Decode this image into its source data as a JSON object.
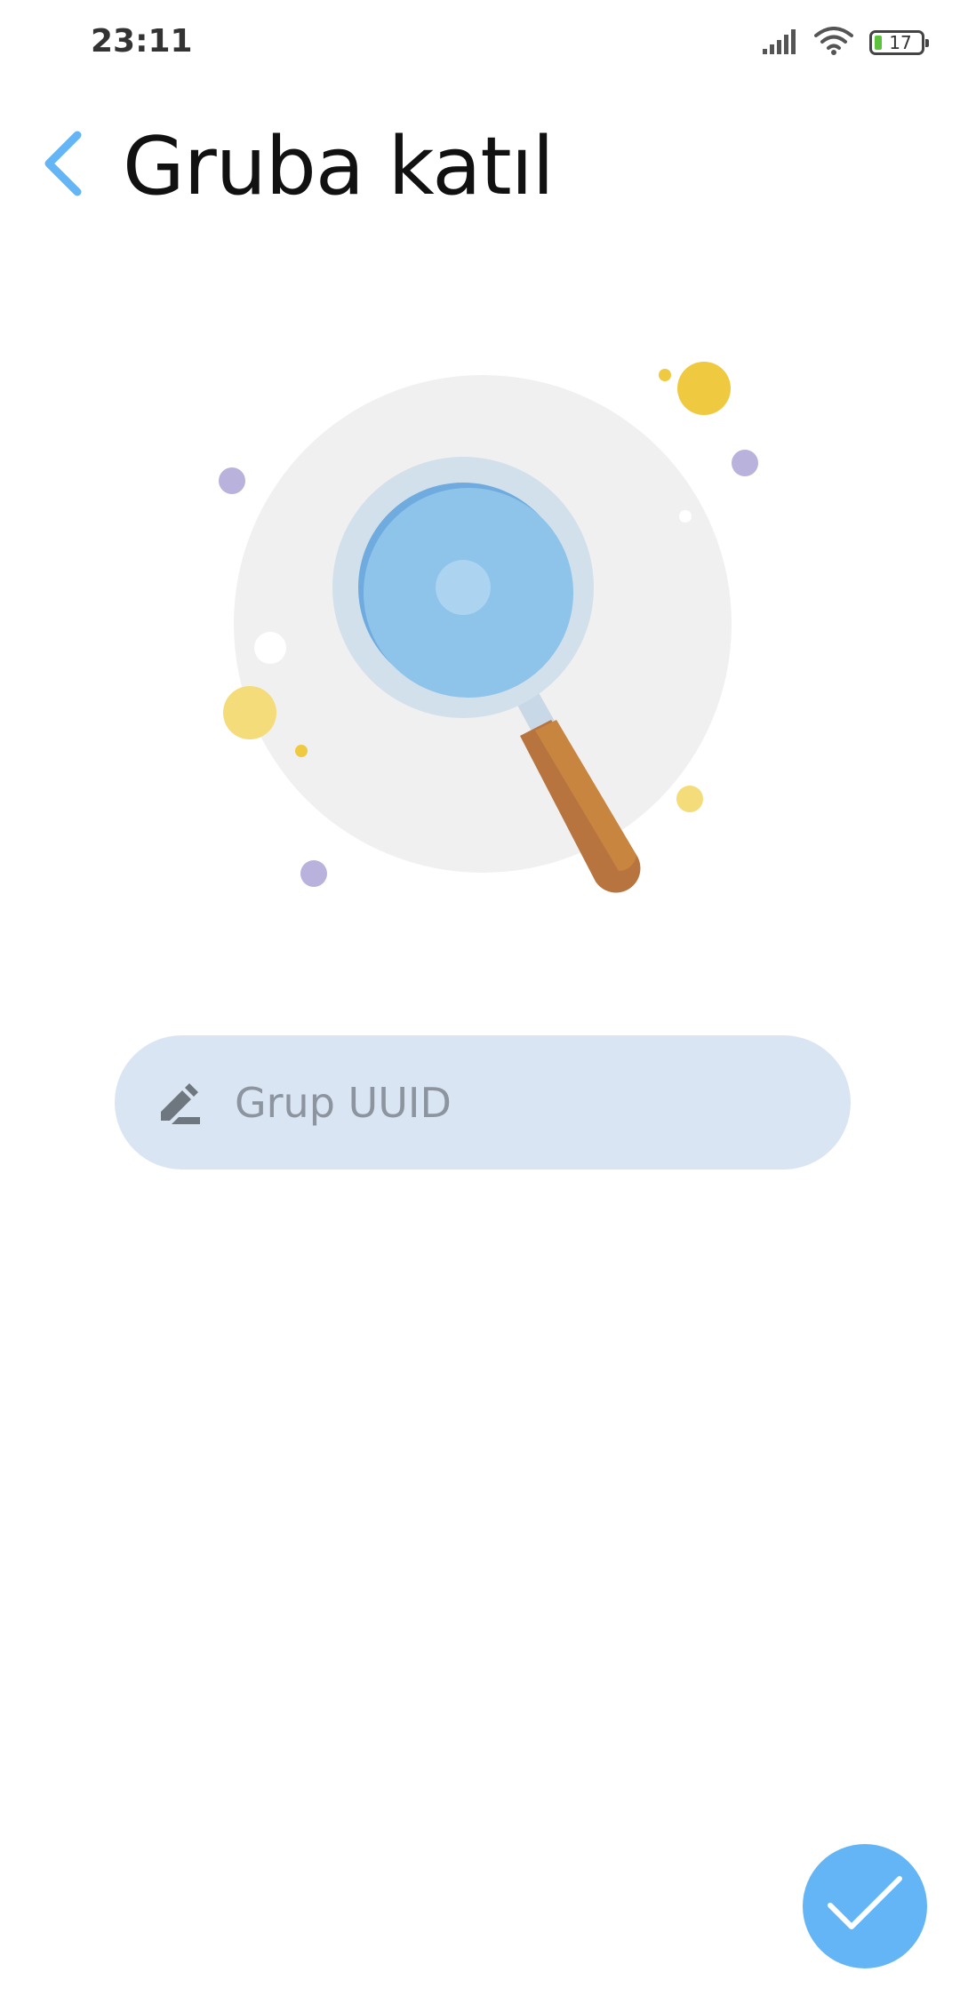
{
  "status_bar": {
    "time": "23:11",
    "battery_level": "17",
    "icons": [
      "signal-icon",
      "wifi-icon",
      "battery-icon"
    ]
  },
  "app_bar": {
    "title": "Gruba katıl",
    "back_icon": "chevron-left-icon"
  },
  "illustration": {
    "icon": "magnifying-glass-illustration"
  },
  "form": {
    "uuid_placeholder": "Grup UUID",
    "uuid_value": "",
    "field_icon": "edit-pencil-icon"
  },
  "fab": {
    "icon": "checkmark-icon"
  },
  "colors": {
    "accent": "#64b5f6",
    "input_bg": "#dae5f4",
    "placeholder": "#8b949f",
    "title": "#111111"
  }
}
